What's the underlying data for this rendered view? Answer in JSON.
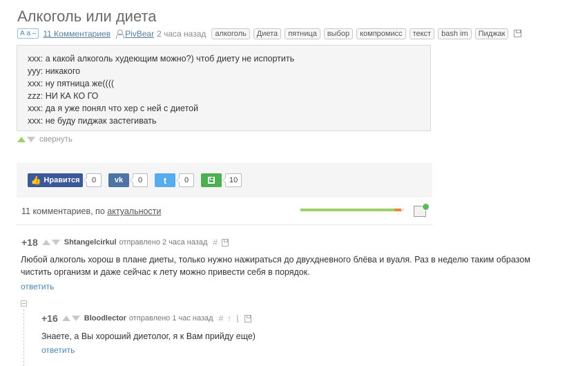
{
  "post": {
    "title": "Алкоголь или диета",
    "text_size_label": "А а –",
    "comments_link": "11 Комментариев",
    "author": "PivBear",
    "time": "2 часа назад",
    "tags": [
      "алкоголь",
      "Диета",
      "пятница",
      "выбор",
      "компромисс",
      "текст",
      "bash im",
      "Пиджак"
    ],
    "lines": [
      "xxx: а какой алкоголь худеющим можно?) чтоб диету не испортить",
      "yyy: никакого",
      "xxx: ну пятница же((((",
      "zzz: НИ КА КО ГО",
      "xxx: да я уже понял что хер с ней с диетой",
      "xxx: не буду пиджак застегивать"
    ],
    "collapse_label": "свернуть"
  },
  "share": {
    "like_label": "Нравится",
    "like_count": "0",
    "vk_count": "0",
    "twitter_count": "0",
    "save_count": "10",
    "vk_label": "vk",
    "twitter_label": "t"
  },
  "comments_header": {
    "prefix": "11 комментариев, по",
    "sort_label": "актуальности",
    "progress": 0.97
  },
  "comments": [
    {
      "rating": "+18",
      "author": "Shtangelcirkul",
      "sent": "отправлено 2 часа назад",
      "hash": "#",
      "text_line1": "Любой алкоголь хорош в плане диеты, только нужно нажираться до двухдневного блёва и вуаля. Раз в неделю таким образом",
      "text_line2": "чистить организм и даже сейчас к лету можно привести себя в порядок.",
      "reply": "ответить"
    },
    {
      "rating": "+16",
      "author": "Bloodlector",
      "sent": "отправлено 1 час назад",
      "hash": "#",
      "text_line1": "Знаете, а Вы хороший диетолог, я к Вам прийду еще)",
      "reply": "ответить"
    }
  ],
  "colors": {
    "accent": "#4a86b3",
    "upvote": "#9ed06a",
    "like": "#3b5998",
    "vk": "#4c75a3",
    "twitter": "#55acee",
    "save": "#4caf50"
  }
}
